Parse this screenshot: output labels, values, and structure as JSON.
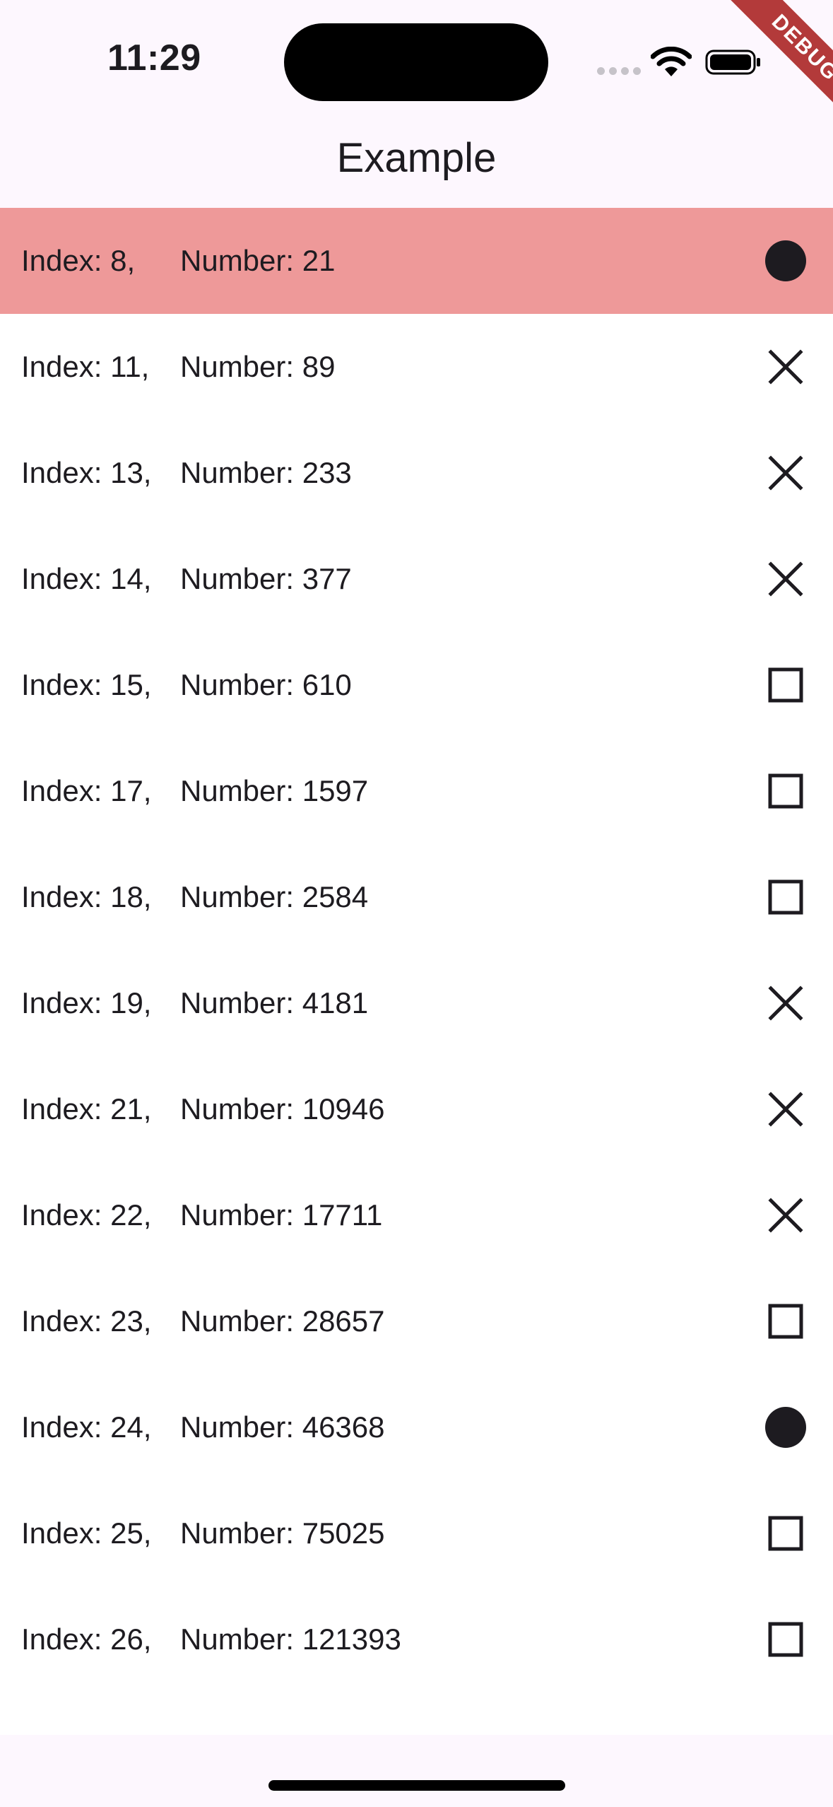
{
  "status_bar": {
    "time": "11:29"
  },
  "debug_banner": "DEBUG",
  "app_bar": {
    "title": "Example"
  },
  "colors": {
    "selected_row": "#ee9999",
    "background": "#fdf7fe",
    "icon": "#1d1b20"
  },
  "list": [
    {
      "index": "Index: 8,",
      "number": "Number: 21",
      "icon": "filled-circle-icon",
      "selected": true
    },
    {
      "index": "Index: 11,",
      "number": "Number: 89",
      "icon": "close-icon"
    },
    {
      "index": "Index: 13,",
      "number": "Number: 233",
      "icon": "close-icon"
    },
    {
      "index": "Index: 14,",
      "number": "Number: 377",
      "icon": "close-icon"
    },
    {
      "index": "Index: 15,",
      "number": "Number: 610",
      "icon": "square-outline-icon"
    },
    {
      "index": "Index: 17,",
      "number": "Number: 1597",
      "icon": "square-outline-icon"
    },
    {
      "index": "Index: 18,",
      "number": "Number: 2584",
      "icon": "square-outline-icon"
    },
    {
      "index": "Index: 19,",
      "number": "Number: 4181",
      "icon": "close-icon"
    },
    {
      "index": "Index: 21,",
      "number": "Number: 10946",
      "icon": "close-icon"
    },
    {
      "index": "Index: 22,",
      "number": "Number: 17711",
      "icon": "close-icon"
    },
    {
      "index": "Index: 23,",
      "number": "Number: 28657",
      "icon": "square-outline-icon"
    },
    {
      "index": "Index: 24,",
      "number": "Number: 46368",
      "icon": "filled-circle-icon"
    },
    {
      "index": "Index: 25,",
      "number": "Number: 75025",
      "icon": "square-outline-icon"
    },
    {
      "index": "Index: 26,",
      "number": "Number: 121393",
      "icon": "square-outline-icon"
    }
  ]
}
